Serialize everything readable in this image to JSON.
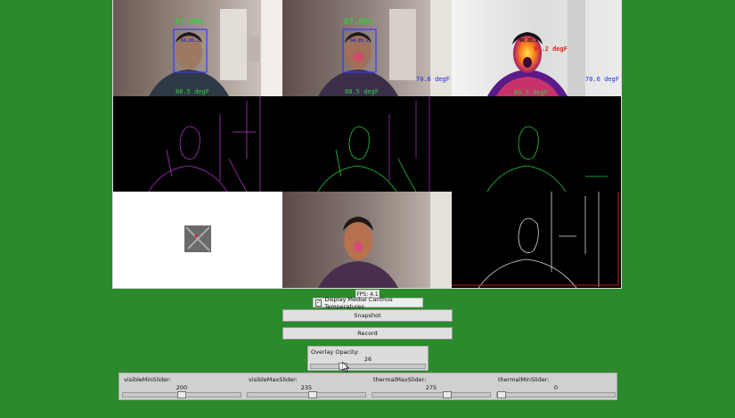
{
  "overlays": {
    "confidence_1": "87.06%",
    "confidence_2": "87.06%",
    "face_box_temp_1": "94.85.1",
    "face_box_temp_2": "94.85.1",
    "face_box_temp_3": "94.85.1",
    "canthus_temp": "94.2 degF",
    "forehead_temp_1": "88.5 degF",
    "forehead_temp_2": "88.5 degF",
    "forehead_temp_3": "88.5 degF",
    "ambient_temp_1": "70.6 degF",
    "ambient_temp_2": "70.6 degF"
  },
  "fps": "FPS: 4.1",
  "medial_canthus": {
    "label": "Display Medial Canthus Temperatures",
    "checked": true,
    "check_mark": "✓"
  },
  "buttons": {
    "snapshot": "Snapshot",
    "record": "Record"
  },
  "overlay_opacity": {
    "label": "Overlay Opacity:",
    "value": "26",
    "fraction": 0.26
  },
  "sliders": [
    {
      "label": "visibleMinSlider:",
      "value": "200",
      "fraction": 0.5
    },
    {
      "label": "visibleMaxSlider:",
      "value": "235",
      "fraction": 0.56
    },
    {
      "label": "thermalMaxSlider:",
      "value": "275",
      "fraction": 0.65
    },
    {
      "label": "thermalMinSlider:",
      "value": "0",
      "fraction": 0.0
    }
  ],
  "colors": {
    "background": "#2b8a2b",
    "label_green": "#2dd23a",
    "label_blue": "#1f2ad8",
    "label_red": "#e02020",
    "edge_purple": "#b030c8",
    "edge_green": "#22c83a"
  }
}
